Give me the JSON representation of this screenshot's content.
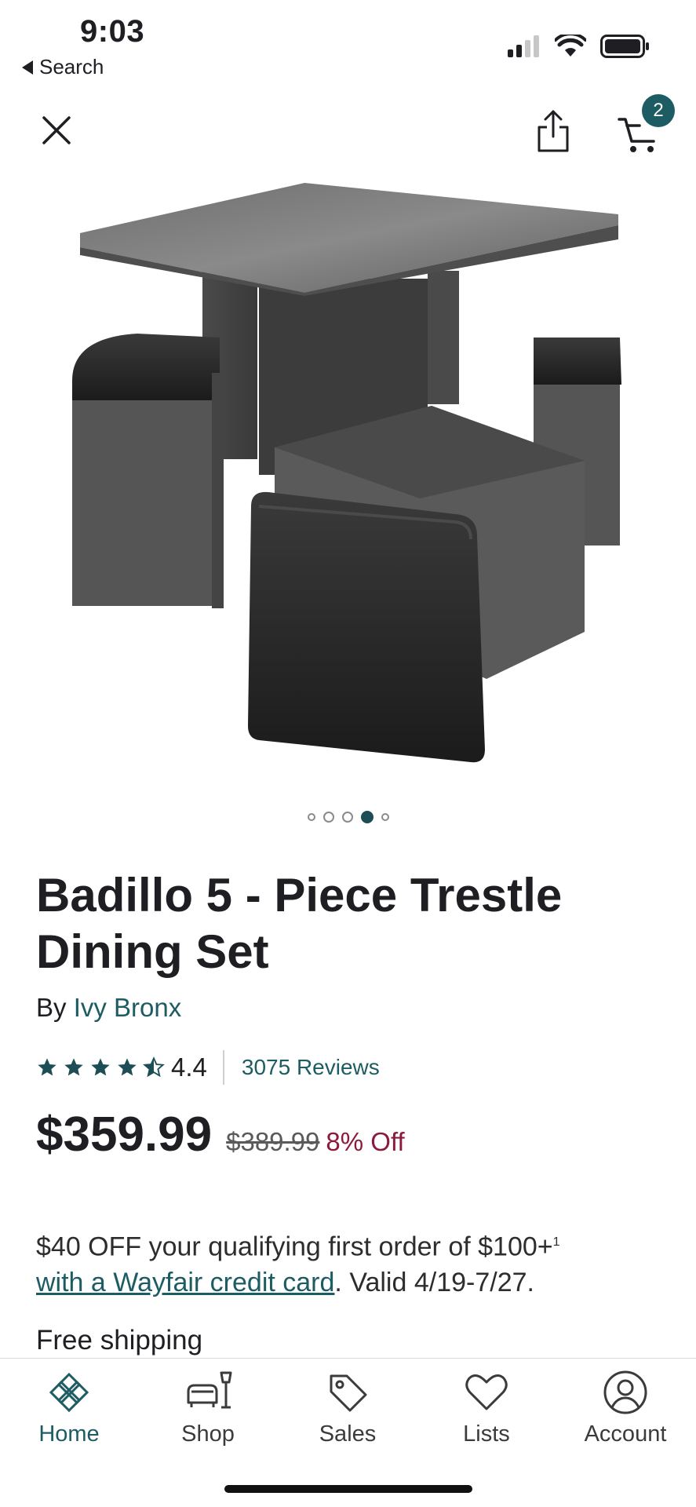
{
  "status_bar": {
    "time": "9:03",
    "back_label": "Search"
  },
  "top_nav": {
    "cart_count": "2"
  },
  "carousel": {
    "dot_count": 5,
    "active_index": 3
  },
  "product": {
    "title": "Badillo 5 - Piece Trestle Dining Set",
    "by_prefix": "By",
    "brand": "Ivy Bronx",
    "rating": "4.4",
    "rating_value": 4.4,
    "reviews": "3075 Reviews",
    "price": "$359.99",
    "old_price": "$389.99",
    "discount": "8% Off"
  },
  "promo": {
    "line1": "$40 OFF your qualifying first order of $100+",
    "footnote": "1",
    "link": "with a Wayfair credit card",
    "suffix": ". Valid 4/19-7/27."
  },
  "shipping": "Free shipping",
  "tabs": [
    {
      "label": "Home",
      "icon": "home-icon",
      "active": true
    },
    {
      "label": "Shop",
      "icon": "furniture-icon",
      "active": false
    },
    {
      "label": "Sales",
      "icon": "tag-icon",
      "active": false
    },
    {
      "label": "Lists",
      "icon": "heart-icon",
      "active": false
    },
    {
      "label": "Account",
      "icon": "account-icon",
      "active": false
    }
  ],
  "colors": {
    "accent": "#1d5c63",
    "discount": "#8b1a3b",
    "text": "#1f1e23"
  }
}
